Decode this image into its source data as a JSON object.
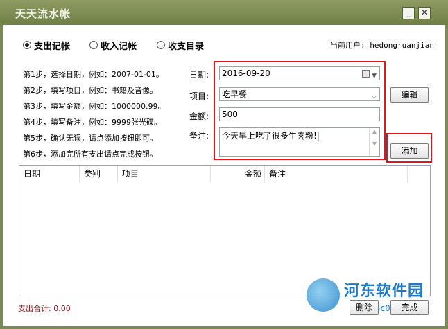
{
  "window": {
    "title": "天天流水帐",
    "minimize": "_",
    "close": "✕"
  },
  "tabs": [
    {
      "label": "支出记帐",
      "selected": true
    },
    {
      "label": "收入记帐",
      "selected": false
    },
    {
      "label": "收支目录",
      "selected": false
    }
  ],
  "current_user": "当前用户: hedongruanjian",
  "steps": [
    "第1步，选择日期，例如：2007-01-01。",
    "第2步，填写项目，例如：书籍及音像。",
    "第3步，填写金额，例如：1000000.99。",
    "第4步，填写备注，例如：9999张光碟。",
    "第5步，确认无误，请点添加按钮即可。",
    "第6步，添加完所有支出请点完成按钮。"
  ],
  "form": {
    "date_label": "日期:",
    "date_value": "2016-09-20",
    "item_label": "项目:",
    "item_value": "吃早餐",
    "amount_label": "金额:",
    "amount_value": "500",
    "note_label": "备注:",
    "note_value": "今天早上吃了很多牛肉粉!|"
  },
  "buttons": {
    "edit": "编辑",
    "add": "添加",
    "delete": "删除",
    "finish": "完成"
  },
  "table": {
    "columns": [
      "日期",
      "类别",
      "项目",
      "金额",
      "备注"
    ]
  },
  "total": "支出合计: 0.00",
  "watermark": {
    "main": "河东软件园",
    "url": "www.pc0359.cn"
  },
  "colors": {
    "titlebar": "#7a8a53",
    "highlight": "#e3131b",
    "total_text": "#8b1a1a",
    "watermark": "#1f78c8"
  }
}
